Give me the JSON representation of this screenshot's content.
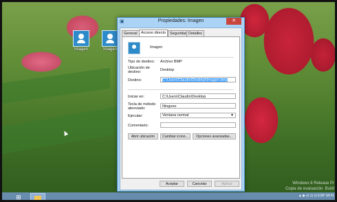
{
  "desktop": {
    "icons": [
      {
        "label": "Imagen",
        "icon": "image-shortcut-icon"
      },
      {
        "label": "Imagen",
        "icon": "image-shortcut-icon"
      }
    ],
    "watermark": {
      "line1": "Windows 8 Release Pr",
      "line2": "Copia de evaluación. Build"
    }
  },
  "dialog": {
    "title": "Propiedades: Imagen",
    "close_glyph": "✕",
    "tabs": [
      "General",
      "Acceso directo",
      "Seguridad",
      "Detalles"
    ],
    "active_tab": "Acceso directo",
    "app_name": "Imagen",
    "fields": {
      "tipo_destino": {
        "label": "Tipo de destino:",
        "value": "Archivo BMP"
      },
      "ubicacion_destino": {
        "label": "Ubicación de destino:",
        "value": "Desktop"
      },
      "destino": {
        "label": "Destino:",
        "value": "C:\\Users\\Claudio\\Desktop\\Imagen.bmp"
      },
      "iniciar_en": {
        "label": "Iniciar en:",
        "value": "C:\\Users\\Claudio\\Desktop"
      },
      "tecla_metodo": {
        "label": "Tecla de método abreviado:",
        "value": "Ninguno"
      },
      "ejecutar": {
        "label": "Ejecutar:",
        "value": "Ventana normal"
      },
      "comentario": {
        "label": "Comentario:",
        "value": ""
      }
    },
    "action_buttons": {
      "abrir_ubicacion": "Abrir ubicación",
      "cambiar_icono": "Cambiar icono...",
      "opciones_avanzadas": "Opciones avanzadas..."
    },
    "footer_buttons": {
      "aceptar": "Aceptar",
      "cancelar": "Cancelar",
      "aplicar": "Aplicar"
    }
  },
  "taskbar": {
    "start_glyph": "⊞",
    "tray_text": "▲ ▶ ⊡ ⊡ ⊡ ESP",
    "clock": "18:41"
  }
}
